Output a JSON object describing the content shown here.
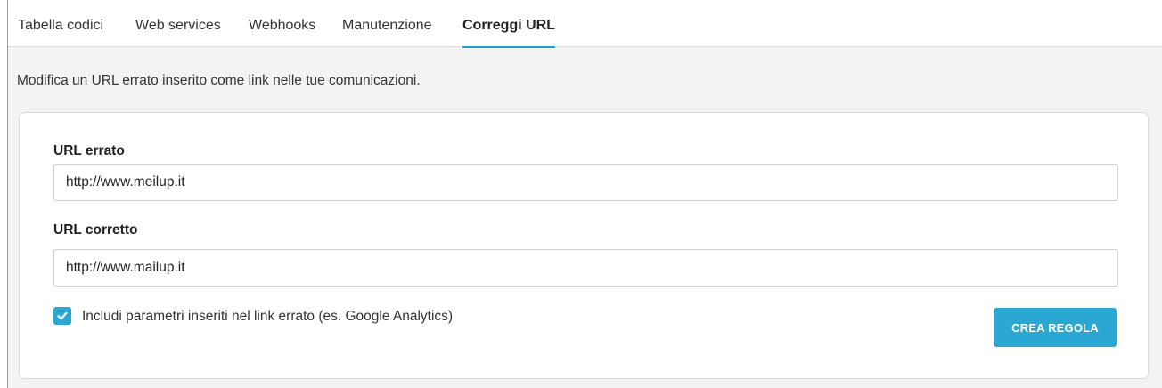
{
  "tabs": [
    {
      "label": "Tabella codici",
      "active": false
    },
    {
      "label": "Web services",
      "active": false
    },
    {
      "label": "Webhooks",
      "active": false
    },
    {
      "label": "Manutenzione",
      "active": false
    },
    {
      "label": "Correggi URL",
      "active": true
    }
  ],
  "description": "Modifica un URL errato inserito come link nelle tue comunicazioni.",
  "form": {
    "wrong_url_label": "URL errato",
    "wrong_url_value": "http://www.meilup.it",
    "correct_url_label": "URL corretto",
    "correct_url_value": "http://www.mailup.it",
    "include_params_label": "Includi parametri inseriti nel link errato (es. Google Analytics)",
    "include_params_checked": true,
    "submit_label": "CREA REGOLA"
  },
  "colors": {
    "accent": "#2aa7d3",
    "tab_underline": "#1aa3cf"
  },
  "icons": {
    "checkbox": "check-icon"
  }
}
